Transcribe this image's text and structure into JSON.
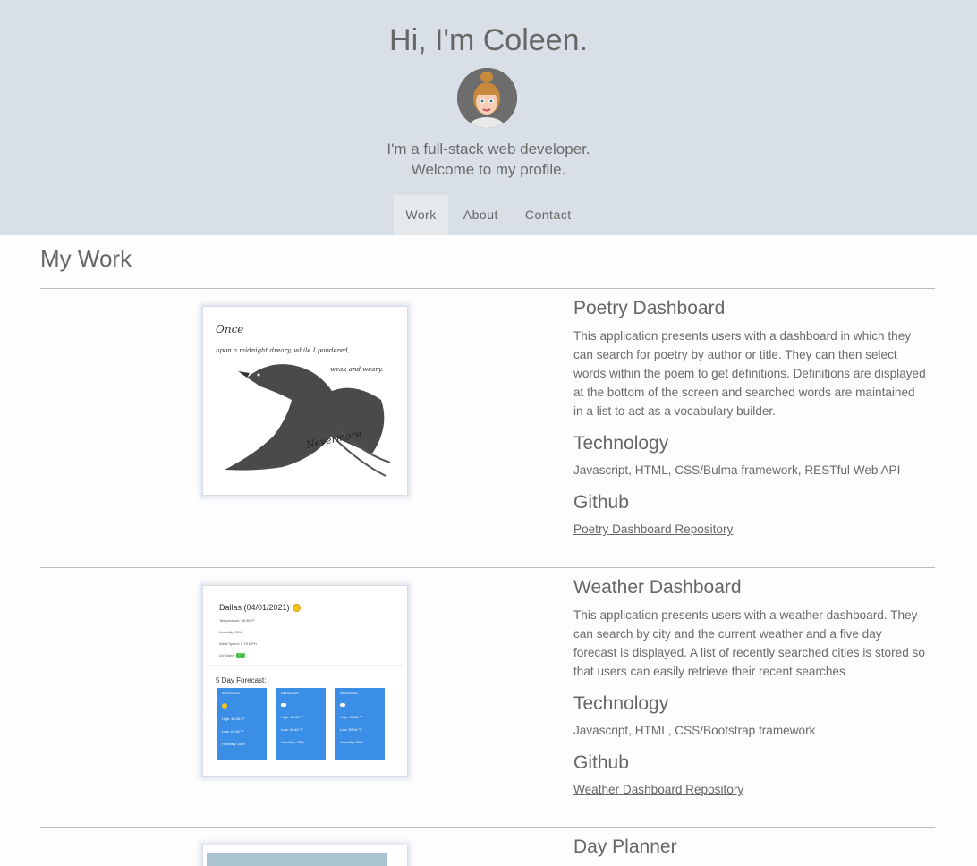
{
  "header": {
    "greeting": "Hi, I'm Coleen.",
    "tagline_line1": "I'm a full-stack web developer.",
    "tagline_line2": "Welcome to my profile."
  },
  "nav": {
    "items": [
      {
        "label": "Work"
      },
      {
        "label": "About"
      },
      {
        "label": "Contact"
      }
    ]
  },
  "main": {
    "section_title": "My Work",
    "projects": [
      {
        "title": "Poetry Dashboard",
        "description": "This application presents users with a dashboard in which they can search for poetry by author or title. They can then select words within the poem to get definitions. Definitions are displayed at the bottom of the screen and searched words are maintained in a list to act as a vocabulary builder.",
        "tech_heading": "Technology",
        "tech": "Javascript, HTML, CSS/Bulma framework, RESTful Web API",
        "github_heading": "Github",
        "link_label": "Poetry Dashboard Repository"
      },
      {
        "title": "Weather Dashboard",
        "description": "This application presents users with a weather dashboard. They can search by city and the current weather and a five day forecast is displayed. A list of recently searched cities is stored so that users can easily retrieve their recent searches",
        "tech_heading": "Technology",
        "tech": "Javascript, HTML, CSS/Bootstrap framework",
        "github_heading": "Github",
        "link_label": "Weather Dashboard Repository"
      },
      {
        "title": "Day Planner"
      }
    ]
  },
  "thumbnails": {
    "poetry": {
      "line1": "Once",
      "line2": "upon a midnight dreary, while I pondered,",
      "line3": "weak and weary.",
      "signature": "Nevermore"
    },
    "weather": {
      "city": "Dallas (04/01/2021)",
      "temp": "Temperature: 66.56 °F",
      "humidity": "Humidity: 95%",
      "wind": "Wind Speed: 5.75 MPH",
      "uv_label": "UV Index:",
      "uv_value": "0.19",
      "forecast_title": "5 Day Forecast:",
      "cards": [
        {
          "date": "04/01/2021",
          "high": "High: 66.56 °F",
          "low": "Low: 47.95 °F",
          "hum": "Humidity: 20%"
        },
        {
          "date": "04/02/2021",
          "high": "High: 64.08 °F",
          "low": "Low: 46.45 °F",
          "hum": "Humidity: 39%"
        },
        {
          "date": "04/03/2021",
          "high": "High: 62.82 °F",
          "low": "Low: 50.34 °F",
          "hum": "Humidity: 50%"
        }
      ]
    }
  }
}
